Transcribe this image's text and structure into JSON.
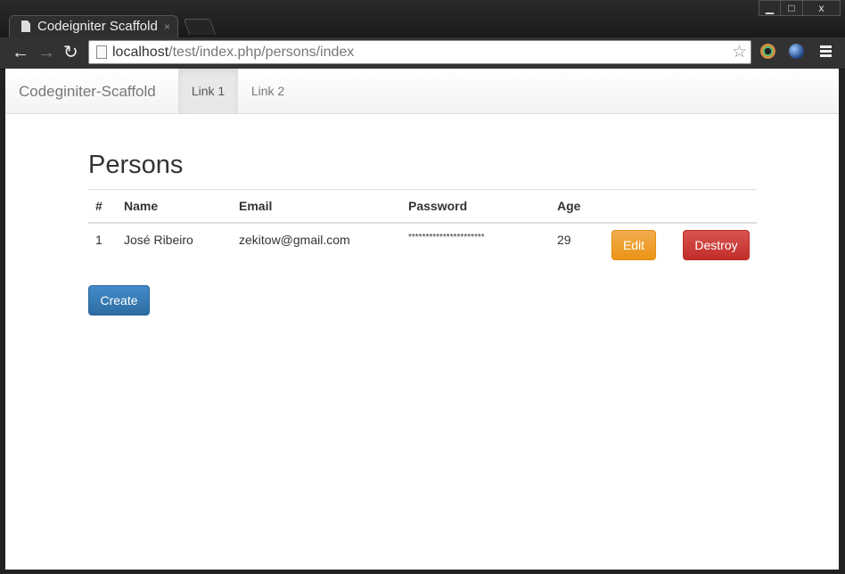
{
  "browser": {
    "tab_title": "Codeigniter Scaffold",
    "tab_close": "×",
    "window_controls": {
      "minimize": "▁",
      "maximize": "□",
      "close": "x"
    },
    "url_host": "localhost",
    "url_path": "/test/index.php/persons/index",
    "icons": {
      "back": "←",
      "forward": "→",
      "reload": "↻",
      "star": "☆"
    }
  },
  "navbar": {
    "brand": "Codeginiter-Scaffold",
    "links": [
      "Link 1",
      "Link 2"
    ],
    "active_link": "Link 1"
  },
  "page": {
    "title": "Persons",
    "table": {
      "headers": [
        "#",
        "Name",
        "Email",
        "Password",
        "Age"
      ],
      "rows": [
        {
          "id": "1",
          "name": "José Ribeiro",
          "email": "zekitow@gmail.com",
          "password": "**********************",
          "age": "29"
        }
      ]
    },
    "row_actions": {
      "edit": "Edit",
      "destroy": "Destroy"
    },
    "create_label": "Create"
  },
  "colors": {
    "edit": "#f0ad4e",
    "destroy": "#d9534f",
    "create": "#428bca"
  }
}
